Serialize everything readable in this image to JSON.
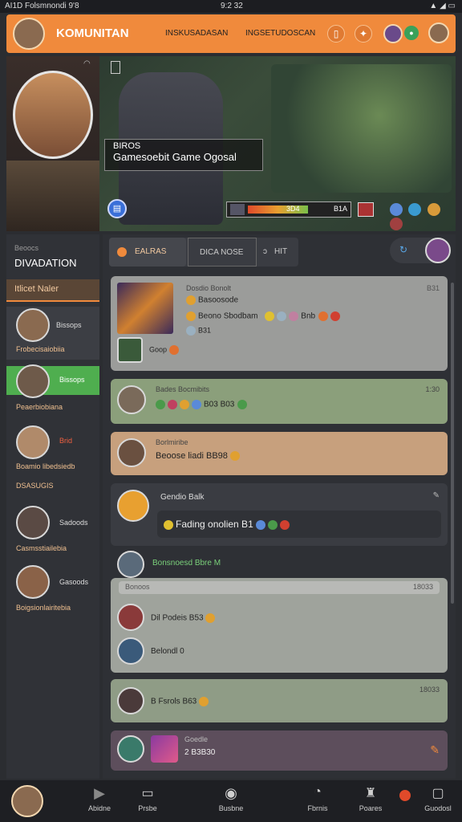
{
  "status": {
    "left": "AI1D Folsmnondi 9'8",
    "time": "9:2 32"
  },
  "topbar": {
    "title": "KOMUNITAN",
    "tab1": "INSKUSADASAN",
    "tab2": "INGSETUDOSCAN"
  },
  "hero": {
    "line1": "BIROS",
    "line2": "Gamesoebit Game Ogosal",
    "progress_label": "3D4",
    "progress_value_text": "B1A",
    "progress": 0.75
  },
  "sidebar": {
    "title_small": "Beoocs",
    "title": "DIVADATION",
    "section": "Itlicet Naler",
    "items": [
      {
        "label": "Bissops",
        "sub": "Frobecisaiobiia"
      },
      {
        "label": "Bissops",
        "sub": "Peaerbiobiana"
      },
      {
        "label": "Brid",
        "sub": "Boamio libedsiedb"
      },
      {
        "label": "",
        "sub": "DSASUGIS"
      },
      {
        "label": "Sadoods",
        "sub": "Casmsstiailebia"
      },
      {
        "label": "Gasoods",
        "sub": "Boigsionlairitebia"
      }
    ]
  },
  "tabs": [
    "EALRAS",
    "DICA NOSE",
    "HIT"
  ],
  "feed": [
    {
      "title": "Dosdio Bonolt",
      "time": "B31",
      "l1": "Basoosode",
      "l2": "Beono Sbodbam",
      "l3": "B31",
      "tail": "Goop",
      "meta": "Bnb"
    },
    {
      "title": "Bades Bocmibits",
      "time": "1:30",
      "line": "B03  B03"
    },
    {
      "title": "Borlmiribe",
      "line": "Beoose liadi  BB98"
    },
    {
      "title": "Gendio Balk",
      "line": "Fading onolien  B1"
    },
    {
      "title": "Bonsnoesd Bbre M"
    },
    {
      "title": "Bonoos",
      "time": "18033"
    },
    {
      "line": "Dil Podeis  B53"
    },
    {
      "line": "Belondl 0"
    },
    {
      "time": "18033",
      "line": "B Fsrols  B63"
    },
    {
      "title": "Goedle",
      "line": "2  B3B30"
    }
  ],
  "bottomnav": [
    "Abidne",
    "Prsbe",
    "Busbne",
    "Fbrnis",
    "Poares",
    "Guodosl"
  ],
  "colors": {
    "accent": "#f08a3c",
    "bg": "#2b2d31"
  }
}
